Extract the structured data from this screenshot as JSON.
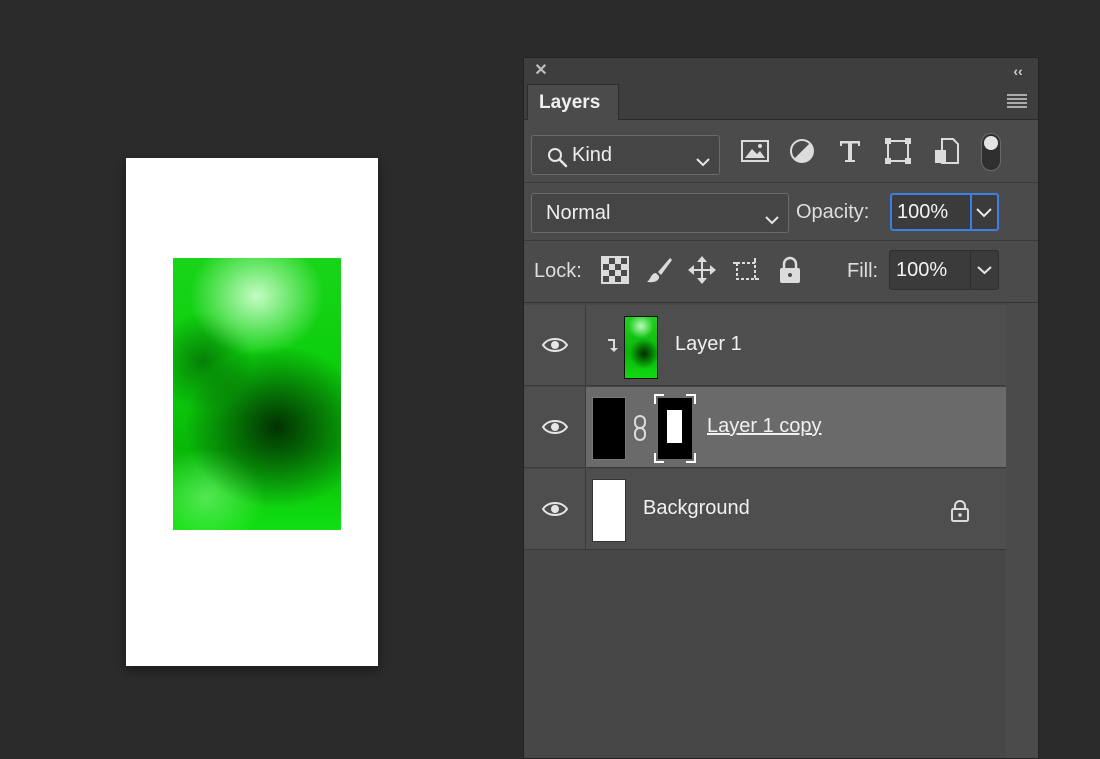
{
  "panel": {
    "tab_label": "Layers",
    "icons": {
      "close": "close-icon",
      "collapse": "double-chevron-left-icon",
      "menu": "panel-menu-icon"
    }
  },
  "filter": {
    "kind_label": "Kind",
    "icons": [
      "image-filter-icon",
      "adjustment-filter-icon",
      "type-filter-icon",
      "shape-filter-icon",
      "smart-object-filter-icon"
    ],
    "toggle_on": true
  },
  "blend": {
    "mode": "Normal",
    "opacity_label": "Opacity:",
    "opacity_value": "100%"
  },
  "lock": {
    "label": "Lock:",
    "icons": [
      "lock-transparent-pixels-icon",
      "lock-image-pixels-icon",
      "lock-position-icon",
      "lock-artboard-icon",
      "lock-all-icon"
    ],
    "fill_label": "Fill:",
    "fill_value": "100%"
  },
  "layers": [
    {
      "name": "Layer 1",
      "visible": true,
      "clipped": true,
      "thumbnail": "green-clouds",
      "selected": false
    },
    {
      "name": "Layer 1 copy",
      "visible": true,
      "has_mask": true,
      "linked": true,
      "thumbnail": "black",
      "mask": "white-rect-on-black",
      "selected": true
    },
    {
      "name": "Background",
      "visible": true,
      "locked": true,
      "thumbnail": "white",
      "selected": false
    }
  ],
  "colors": {
    "app_bg": "#2b2b2b",
    "panel_bg": "#4b4b4b",
    "selected_row": "#6a6a6a",
    "focus_outline": "#3d7ee5",
    "canvas_green": "#0ccf0c"
  }
}
